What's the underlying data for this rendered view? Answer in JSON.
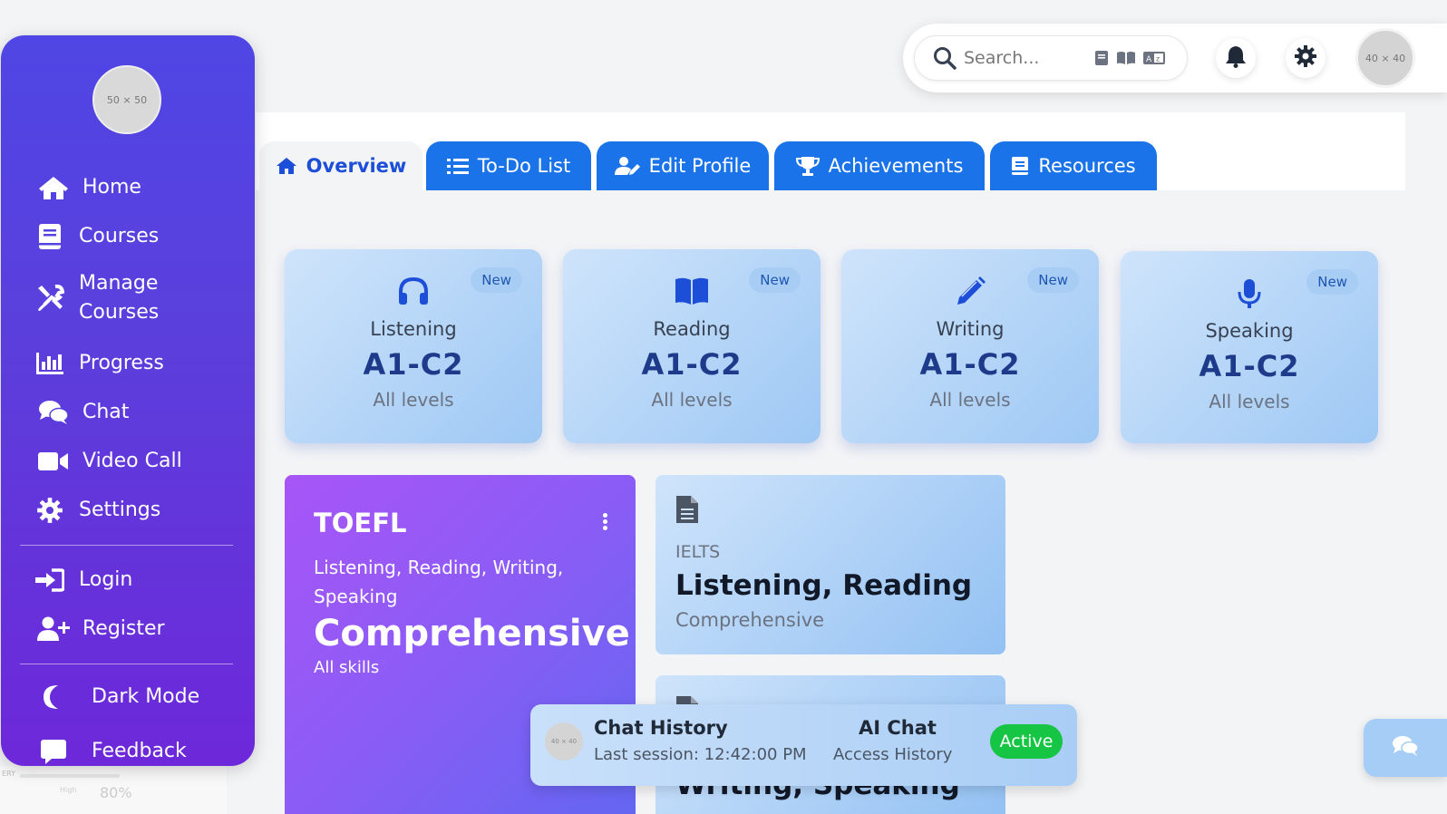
{
  "sidebar": {
    "avatar_placeholder": "50 × 50",
    "items": [
      {
        "label": "Home",
        "icon": "home-icon"
      },
      {
        "label": "Courses",
        "icon": "book-icon"
      },
      {
        "label": "Manage\nCourses",
        "icon": "tools-icon"
      },
      {
        "label": "Progress",
        "icon": "chart-bar-icon"
      },
      {
        "label": "Chat",
        "icon": "chat-bubbles-icon"
      },
      {
        "label": "Video Call",
        "icon": "video-icon"
      },
      {
        "label": "Settings",
        "icon": "gear-icon"
      }
    ],
    "auth_items": [
      {
        "label": "Login",
        "icon": "sign-in-icon"
      },
      {
        "label": "Register",
        "icon": "user-plus-icon"
      }
    ],
    "extra_items": [
      {
        "label": "Dark Mode",
        "icon": "moon-icon"
      },
      {
        "label": "Feedback",
        "icon": "comment-icon"
      }
    ]
  },
  "ghost": {
    "t1": "ERY",
    "t2": "80%",
    "t3": "High"
  },
  "topbar": {
    "search_placeholder": "Search...",
    "avatar_placeholder": "40 × 40"
  },
  "tabs": [
    {
      "label": "Overview",
      "icon": "home-icon",
      "active": true
    },
    {
      "label": "To-Do List",
      "icon": "list-icon"
    },
    {
      "label": "Edit Profile",
      "icon": "user-edit-icon"
    },
    {
      "label": "Achievements",
      "icon": "trophy-icon"
    },
    {
      "label": "Resources",
      "icon": "book-icon"
    }
  ],
  "skills": [
    {
      "badge": "New",
      "name": "Listening",
      "level": "A1-C2",
      "sub": "All levels",
      "icon": "headphones-icon"
    },
    {
      "badge": "New",
      "name": "Reading",
      "level": "A1-C2",
      "sub": "All levels",
      "icon": "book-open-icon"
    },
    {
      "badge": "New",
      "name": "Writing",
      "level": "A1-C2",
      "sub": "All levels",
      "icon": "pencil-icon"
    },
    {
      "badge": "New",
      "name": "Speaking",
      "level": "A1-C2",
      "sub": "All levels",
      "icon": "microphone-icon"
    }
  ],
  "toefl": {
    "title": "TOEFL",
    "skills": "Listening, Reading, Writing, Speaking",
    "big": "Comprehensive",
    "sub": "All skills"
  },
  "ielts": {
    "label": "IELTS",
    "title": "Listening, Reading",
    "sub": "Comprehensive"
  },
  "ielts2": {
    "title": "Writing, Speaking"
  },
  "chat_popup": {
    "avatar_placeholder": "40 × 40",
    "title": "Chat History",
    "last_session": "Last session: 12:42:00 PM",
    "ai_title": "AI Chat",
    "ai_sub": "Access History",
    "status": "Active"
  },
  "colors": {
    "sidebar_top": "#4f46e5",
    "sidebar_bottom": "#6d28d9",
    "tab_blue": "#1a73e8",
    "status_green": "#16c544"
  }
}
